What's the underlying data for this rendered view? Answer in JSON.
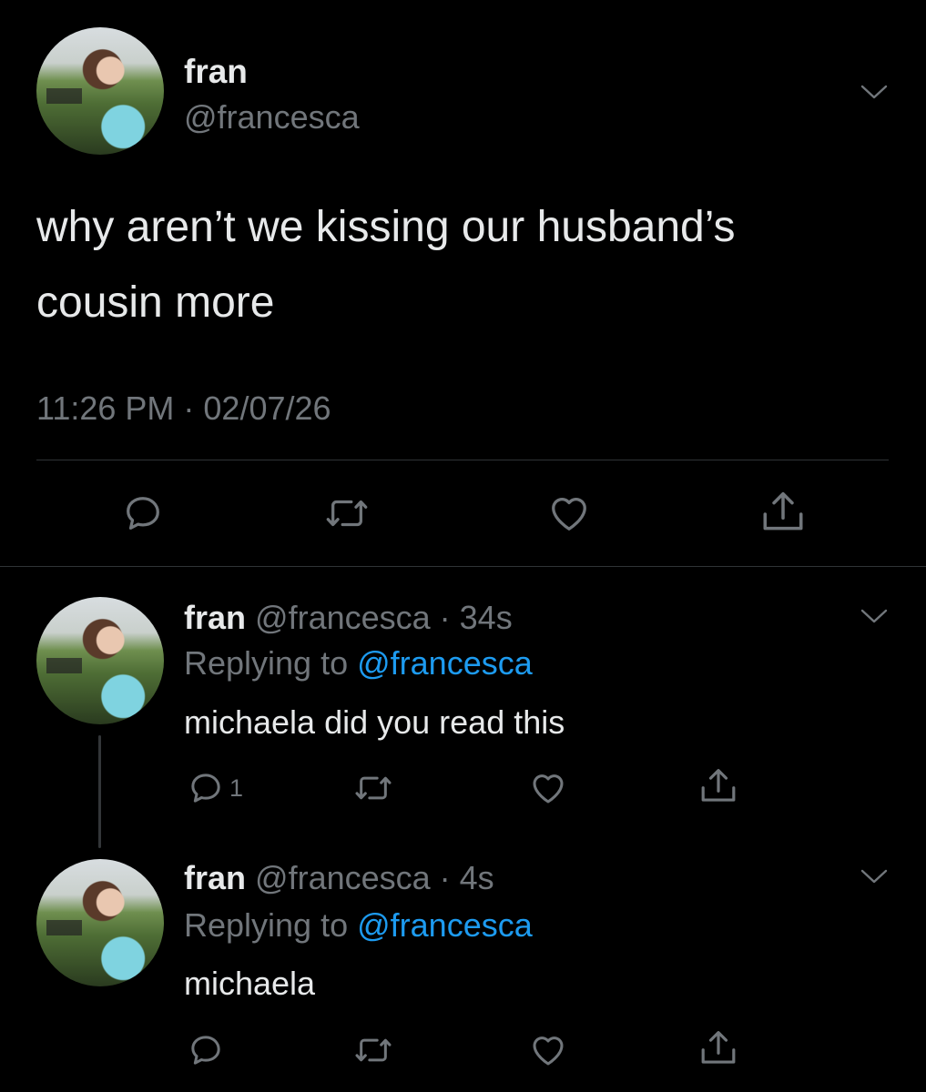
{
  "main_tweet": {
    "display_name": "fran",
    "handle": "@francesca",
    "text_line1": "why aren’t we kissing our husband’s",
    "text_line2": "cousin more",
    "timestamp": "11:26 PM · 02/07/26"
  },
  "replies": [
    {
      "display_name": "fran",
      "handle_time": "@francesca · 34s",
      "replying_prefix": "Replying to",
      "replying_handle": "@francesca",
      "text": "michaela did you read this",
      "reply_count": "1"
    },
    {
      "display_name": "fran",
      "handle_time": "@francesca · 4s",
      "replying_prefix": "Replying to",
      "replying_handle": "@francesca",
      "text": "michaela",
      "reply_count": ""
    }
  ],
  "colors": {
    "background": "#000000",
    "text": "#e7e9ea",
    "muted": "#71767b",
    "accent": "#1d9bf0",
    "divider": "#2f3336"
  },
  "icons": [
    "reply-icon",
    "retweet-icon",
    "like-icon",
    "share-icon",
    "chevron-down-icon"
  ]
}
